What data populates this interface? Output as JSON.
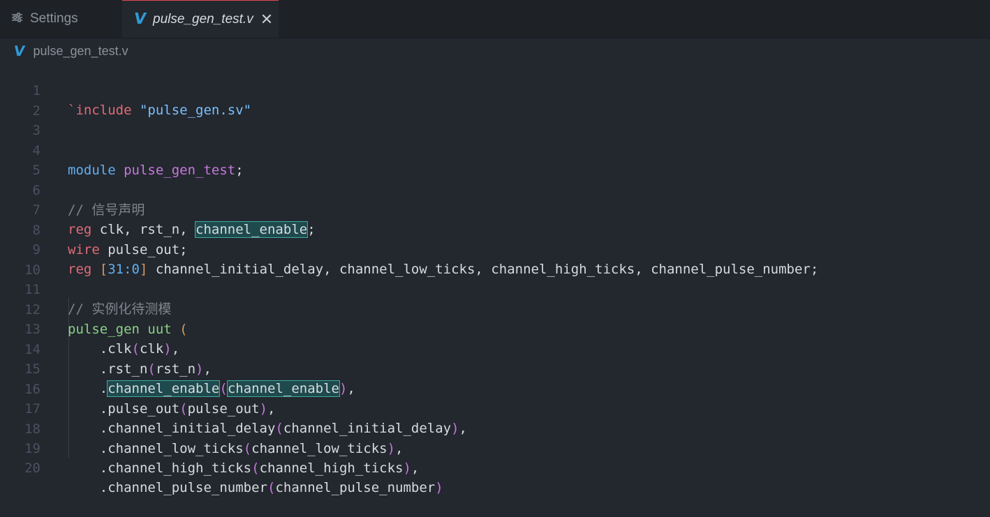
{
  "tabs": [
    {
      "label": "Settings",
      "icon": "settings-sliders-icon",
      "active": false
    },
    {
      "label": "pulse_gen_test.v",
      "icon": "verilog-file-icon",
      "active": true,
      "close_icon": "✕"
    }
  ],
  "breadcrumb": {
    "file": "pulse_gen_test.v",
    "icon": "verilog-file-icon"
  },
  "line_numbers": [
    "1",
    "2",
    "3",
    "4",
    "5",
    "6",
    "7",
    "8",
    "9",
    "10",
    "11",
    "12",
    "13",
    "14",
    "15",
    "16",
    "17",
    "18",
    "19",
    "20"
  ],
  "code": {
    "l1_directive": "`include",
    "l1_string": "\"pulse_gen.sv\"",
    "l4_kw": "module",
    "l4_name": "pulse_gen_test",
    "l4_semi": ";",
    "l6_comment": "// 信号声明",
    "l7_kw": "reg",
    "l7_text": " clk, rst_n, ",
    "l7_hl": "channel_enable",
    "l7_end": ";",
    "l8_kw": "wire",
    "l8_text": " pulse_out;",
    "l9_kw": "reg",
    "l9_br1": " [",
    "l9_range": "31:0",
    "l9_br2": "]",
    "l9_text": " channel_initial_delay, channel_low_ticks, channel_high_ticks, channel_pulse_number;",
    "l11_comment": "// 实例化待测模",
    "l12_mod": "pulse_gen",
    "l12_inst": " uut ",
    "l12_paren": "(",
    "l13": {
      "port": "    .clk",
      "arg": "clk",
      "end": ","
    },
    "l14": {
      "port": "    .rst_n",
      "arg": "rst_n",
      "end": ","
    },
    "l15": {
      "dot": "    .",
      "port": "channel_enable",
      "arg": "channel_enable",
      "end": ","
    },
    "l16": {
      "port": "    .pulse_out",
      "arg": "pulse_out",
      "end": ","
    },
    "l17": {
      "port": "    .channel_initial_delay",
      "arg": "channel_initial_delay",
      "end": ","
    },
    "l18": {
      "port": "    .channel_low_ticks",
      "arg": "channel_low_ticks",
      "end": ","
    },
    "l19": {
      "port": "    .channel_high_ticks",
      "arg": "channel_high_ticks",
      "end": ","
    },
    "l20": {
      "port": "    .channel_pulse_number",
      "arg": "channel_pulse_number",
      "end": ""
    }
  }
}
